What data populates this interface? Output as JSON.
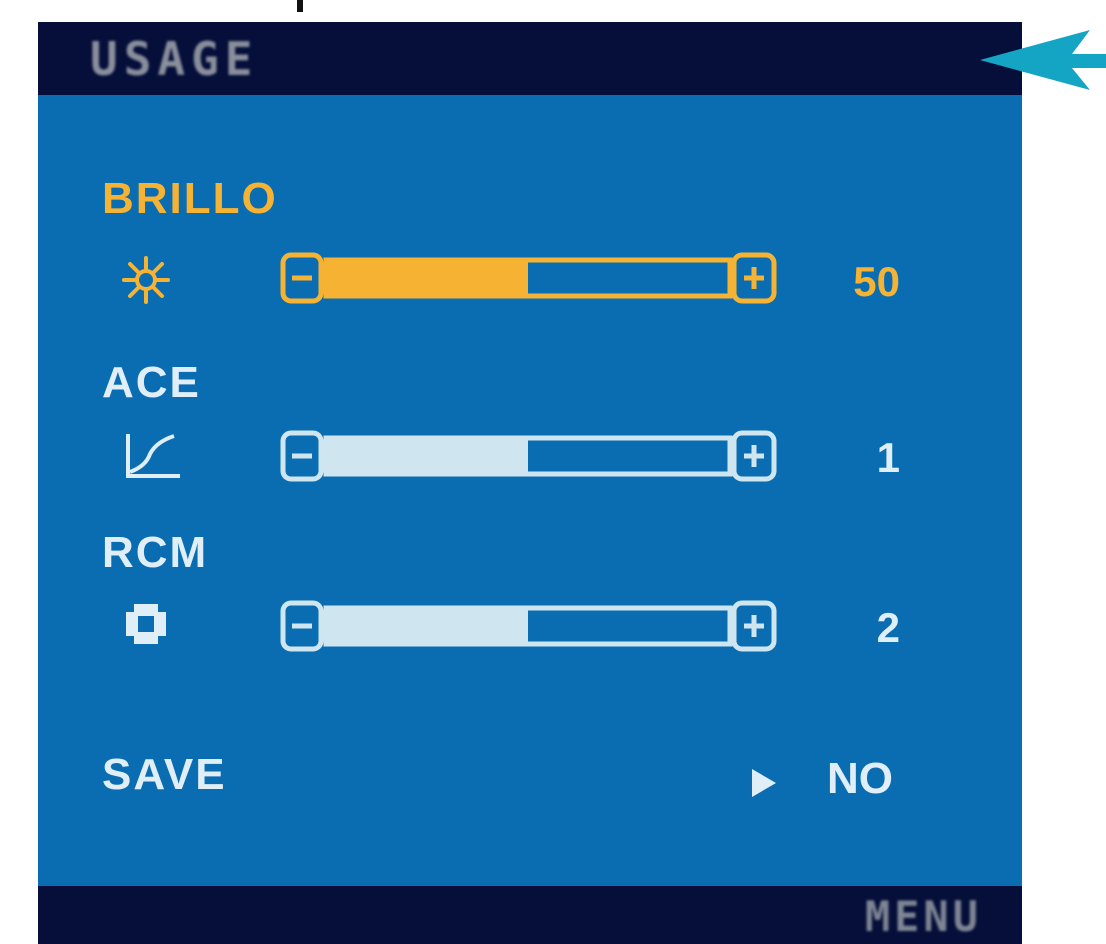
{
  "osd": {
    "title": "USAGE",
    "footer_label": "MENU",
    "colors": {
      "panel": "#0a6db2",
      "bars": "#050f3a",
      "active": "#f6b333",
      "inactive": "#cfe6f1",
      "pointer": "#14a5c4"
    },
    "settings": [
      {
        "label": "BRILLO",
        "icon": "sun-icon",
        "value": "50",
        "fill": 0.5,
        "active": true
      },
      {
        "label": "ACE",
        "icon": "curve-icon",
        "value": "1",
        "fill": 0.5,
        "active": false
      },
      {
        "label": "RCM",
        "icon": "color-pattern-icon",
        "value": "2",
        "fill": 0.5,
        "active": false
      }
    ],
    "save": {
      "label": "SAVE",
      "value": "NO"
    }
  }
}
